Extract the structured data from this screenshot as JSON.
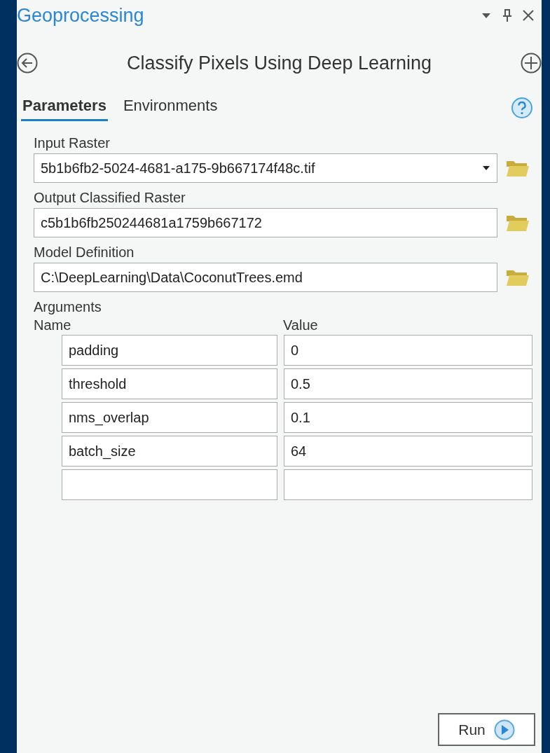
{
  "window": {
    "title": "Geoprocessing"
  },
  "tool": {
    "title": "Classify Pixels Using Deep Learning"
  },
  "tabs": [
    {
      "label": "Parameters",
      "selected": true
    },
    {
      "label": "Environments",
      "selected": false
    }
  ],
  "parameters": [
    {
      "label": "Input Raster",
      "kind": "dropdown",
      "value": "5b1b6fb2-5024-4681-a175-9b667174f48c.tif"
    },
    {
      "label": "Output Classified Raster",
      "kind": "text",
      "value": "c5b1b6fb250244681a1759b667172"
    },
    {
      "label": "Model Definition",
      "kind": "text",
      "value": "C:\\DeepLearning\\Data\\CoconutTrees.emd"
    }
  ],
  "arguments": {
    "label": "Arguments",
    "columns": [
      "Name",
      "Value"
    ],
    "rows": [
      {
        "name": "padding",
        "value": "0"
      },
      {
        "name": "threshold",
        "value": "0.5"
      },
      {
        "name": "nms_overlap",
        "value": "0.1"
      },
      {
        "name": "batch_size",
        "value": "64"
      },
      {}
    ]
  },
  "run_button": {
    "label": "Run"
  }
}
